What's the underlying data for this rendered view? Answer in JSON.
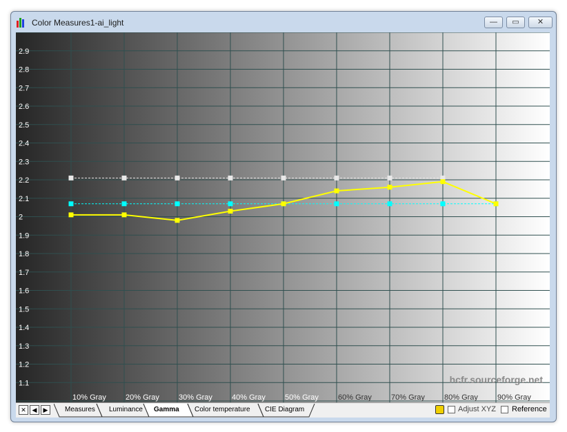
{
  "window": {
    "title": "Color Measures1-ai_light",
    "minimize_glyph": "—",
    "restore_glyph": "▭",
    "close_glyph": "✕"
  },
  "watermark": "hcfr.sourceforge.net",
  "colors": {
    "yellow": "#ffff00",
    "cyan": "#00ffff",
    "white": "#e8e8e8",
    "grid": "#2f4f4f"
  },
  "chart_data": {
    "type": "line",
    "categories": [
      "10% Gray",
      "20% Gray",
      "30% Gray",
      "40% Gray",
      "50% Gray",
      "60% Gray",
      "70% Gray",
      "80% Gray",
      "90% Gray"
    ],
    "y_ticks": [
      "2.9",
      "2.8",
      "2.7",
      "2.6",
      "2.5",
      "2.4",
      "2.3",
      "2.2",
      "2.1",
      "2",
      "1.9",
      "1.8",
      "1.7",
      "1.6",
      "1.5",
      "1.4",
      "1.3",
      "1.2",
      "1.1"
    ],
    "ylim": [
      1.0,
      3.0
    ],
    "grid": true,
    "series": [
      {
        "color": "#ffff00",
        "style": "solid",
        "values": [
          2.01,
          2.01,
          1.98,
          2.03,
          2.07,
          2.14,
          2.16,
          2.19,
          2.07
        ]
      },
      {
        "color": "#00ffff",
        "style": "dashed",
        "values": [
          2.07,
          2.07,
          2.07,
          2.07,
          2.07,
          2.07,
          2.07,
          2.07,
          2.07
        ]
      },
      {
        "color": "#e8e8e8",
        "style": "dashed",
        "values": [
          2.21,
          2.21,
          2.21,
          2.21,
          2.21,
          2.21,
          2.21,
          2.21
        ]
      }
    ]
  },
  "statusbar": {
    "nav": {
      "close": "✕",
      "prev": "◀",
      "next": "▶"
    },
    "tabs": [
      "Measures",
      "Luminance",
      "Gamma",
      "Color temperature",
      "CIE Diagram"
    ],
    "active_tab": 2,
    "adjust_xyz": "Adjust XYZ",
    "reference": "Reference"
  }
}
